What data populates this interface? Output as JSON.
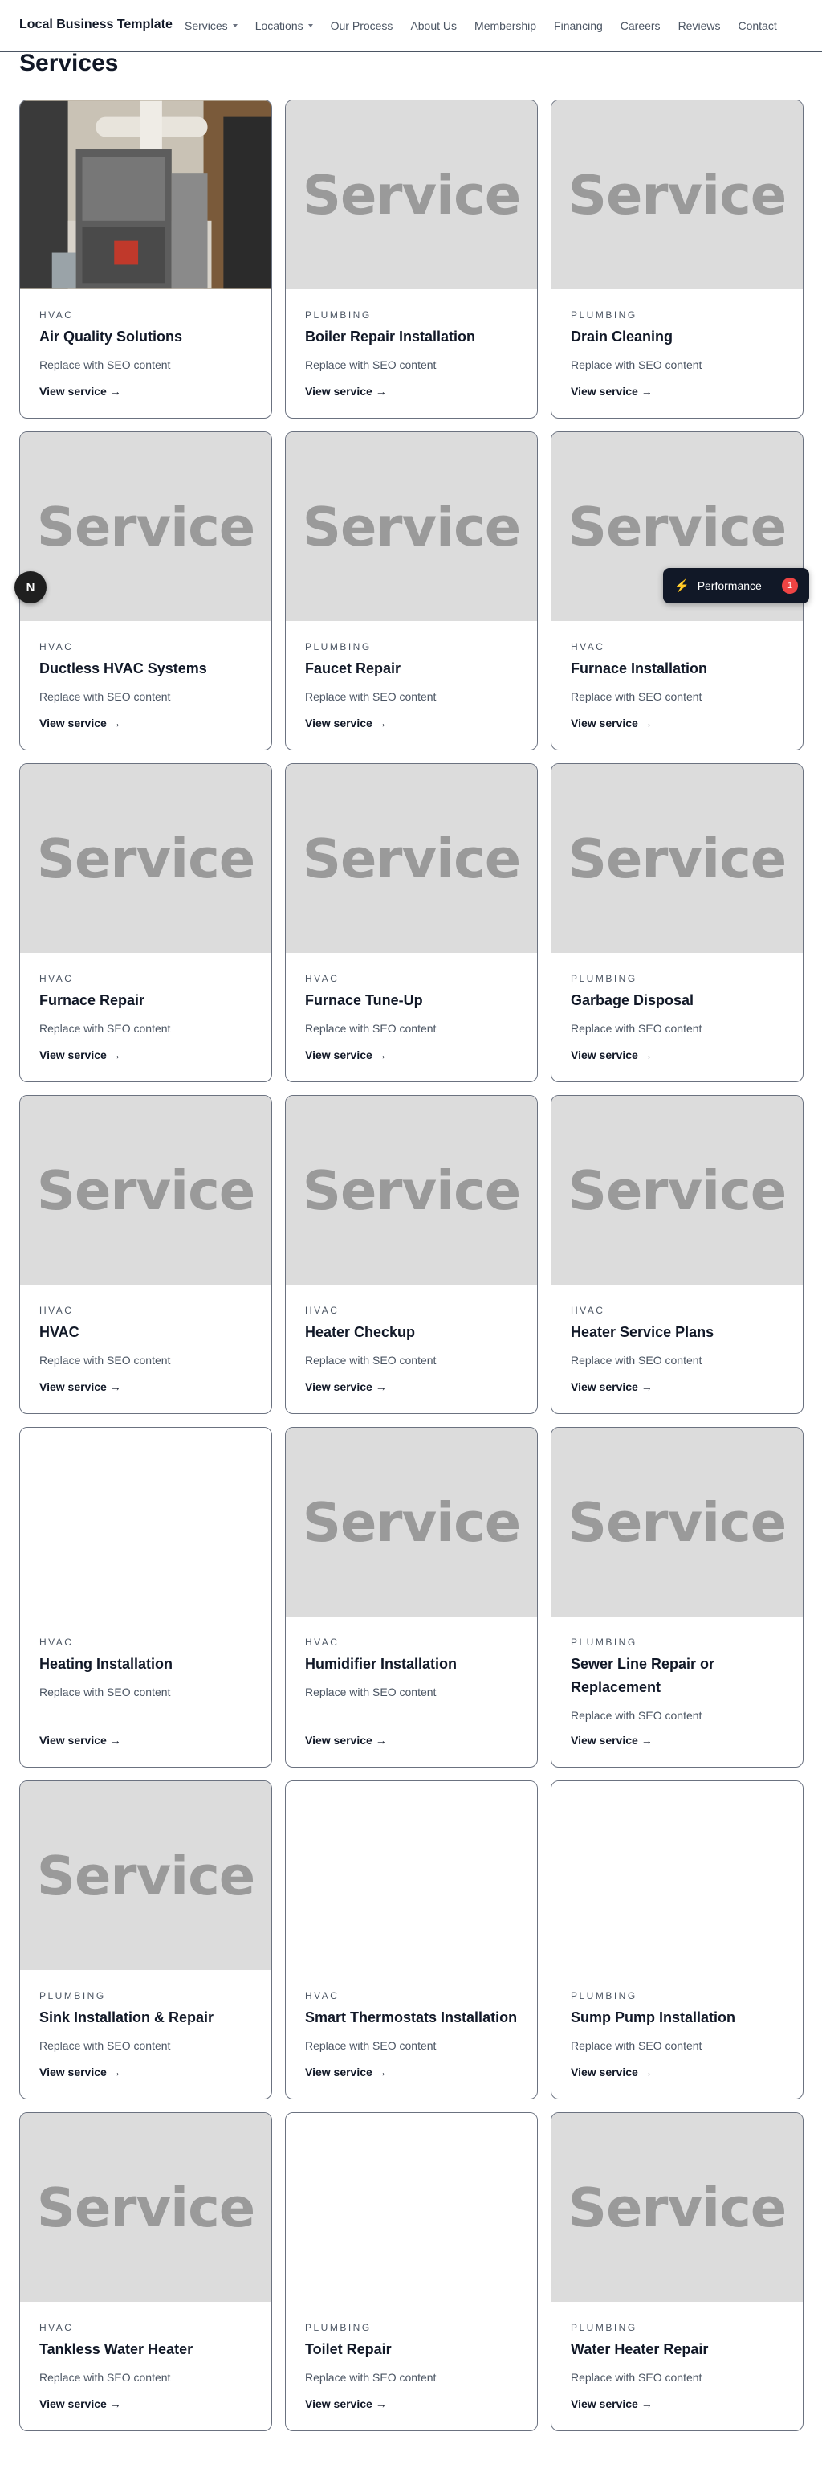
{
  "nav": {
    "brand": "Local Business Template",
    "links": [
      {
        "label": "Services",
        "dropdown": true
      },
      {
        "label": "Locations",
        "dropdown": true
      },
      {
        "label": "Our Process",
        "dropdown": false
      },
      {
        "label": "About Us",
        "dropdown": false
      },
      {
        "label": "Membership",
        "dropdown": false
      },
      {
        "label": "Financing",
        "dropdown": false
      },
      {
        "label": "Careers",
        "dropdown": false
      },
      {
        "label": "Reviews",
        "dropdown": false
      },
      {
        "label": "Contact",
        "dropdown": false
      }
    ]
  },
  "page": {
    "title": "Services"
  },
  "placeholder_text": "Service",
  "services": [
    {
      "category": "HVAC",
      "title": "Air Quality Solutions",
      "description": "Replace with SEO content",
      "link": "View service →",
      "image": "photo"
    },
    {
      "category": "PLUMBING",
      "title": "Boiler Repair Installation",
      "description": "Replace with SEO content",
      "link": "View service →",
      "image": "placeholder"
    },
    {
      "category": "PLUMBING",
      "title": "Drain Cleaning",
      "description": "Replace with SEO content",
      "link": "View service →",
      "image": "placeholder"
    },
    {
      "category": "HVAC",
      "title": "Ductless HVAC Systems",
      "description": "Replace with SEO content",
      "link": "View service →",
      "image": "placeholder"
    },
    {
      "category": "PLUMBING",
      "title": "Faucet Repair",
      "description": "Replace with SEO content",
      "link": "View service →",
      "image": "placeholder"
    },
    {
      "category": "HVAC",
      "title": "Furnace Installation",
      "description": "Replace with SEO content",
      "link": "View service →",
      "image": "placeholder"
    },
    {
      "category": "HVAC",
      "title": "Furnace Repair",
      "description": "Replace with SEO content",
      "link": "View service →",
      "image": "placeholder"
    },
    {
      "category": "HVAC",
      "title": "Furnace Tune-Up",
      "description": "Replace with SEO content",
      "link": "View service →",
      "image": "placeholder"
    },
    {
      "category": "PLUMBING",
      "title": "Garbage Disposal",
      "description": "Replace with SEO content",
      "link": "View service →",
      "image": "placeholder"
    },
    {
      "category": "HVAC",
      "title": "HVAC",
      "description": "Replace with SEO content",
      "link": "View service →",
      "image": "placeholder"
    },
    {
      "category": "HVAC",
      "title": "Heater Checkup",
      "description": "Replace with SEO content",
      "link": "View service →",
      "image": "placeholder"
    },
    {
      "category": "HVAC",
      "title": "Heater Service Plans",
      "description": "Replace with SEO content",
      "link": "View service →",
      "image": "placeholder"
    },
    {
      "category": "HVAC",
      "title": "Heating Installation",
      "description": "Replace with SEO content",
      "link": "View service →",
      "image": "blank"
    },
    {
      "category": "HVAC",
      "title": "Humidifier Installation",
      "description": "Replace with SEO content",
      "link": "View service →",
      "image": "placeholder"
    },
    {
      "category": "PLUMBING",
      "title": "Sewer Line Repair or Replacement",
      "description": "Replace with SEO content",
      "link": "View service →",
      "image": "placeholder"
    },
    {
      "category": "PLUMBING",
      "title": "Sink Installation & Repair",
      "description": "Replace with SEO content",
      "link": "View service →",
      "image": "placeholder"
    },
    {
      "category": "HVAC",
      "title": "Smart Thermostats Installation",
      "description": "Replace with SEO content",
      "link": "View service →",
      "image": "blank"
    },
    {
      "category": "PLUMBING",
      "title": "Sump Pump Installation",
      "description": "Replace with SEO content",
      "link": "View service →",
      "image": "blank"
    },
    {
      "category": "HVAC",
      "title": "Tankless Water Heater",
      "description": "Replace with SEO content",
      "link": "View service →",
      "image": "placeholder"
    },
    {
      "category": "PLUMBING",
      "title": "Toilet Repair",
      "description": "Replace with SEO content",
      "link": "View service →",
      "image": "blank"
    },
    {
      "category": "PLUMBING",
      "title": "Water Heater Repair",
      "description": "Replace with SEO content",
      "link": "View service →",
      "image": "placeholder"
    }
  ],
  "overlays": {
    "next_badge": "N",
    "perf_label": "Performance",
    "perf_count": "1",
    "perf_icon": "lightning-icon"
  }
}
